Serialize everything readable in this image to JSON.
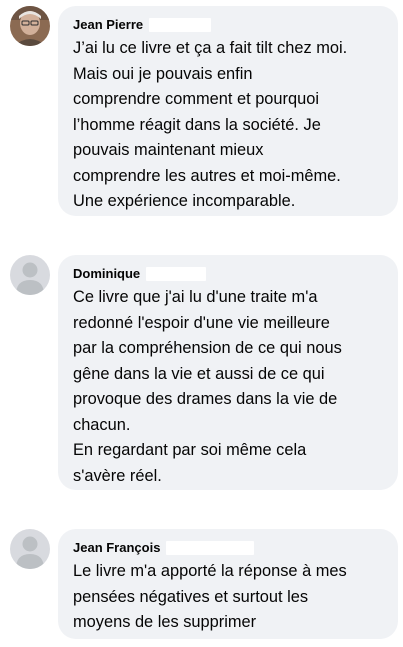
{
  "comments": [
    {
      "author": "Jean Pierre",
      "avatar_icon": "profile-photo",
      "text": "J’ai lu ce livre et ça a fait tilt chez moi.\nMais oui je pouvais enfin\ncomprendre comment et pourquoi\nl’homme réagit dans la société. Je\npouvais maintenant mieux\ncomprendre les autres et moi-même.\nUne expérience incomparable."
    },
    {
      "author": "Dominique",
      "avatar_icon": "default-user-icon",
      "text": "Ce livre que j'ai lu d'une traite m'a\nredonné l'espoir d'une vie meilleure\npar la compréhension de ce qui nous\ngêne dans la vie et aussi de ce qui\nprovoque des drames dans la vie de\nchacun.\nEn regardant par soi même cela\ns'avère réel."
    },
    {
      "author": "Jean François",
      "avatar_icon": "default-user-icon",
      "text": "Le livre m'a apporté la réponse à mes\npensées négatives et surtout les\nmoyens de les supprimer"
    }
  ],
  "colors": {
    "bubble_background": "#f0f2f5",
    "text": "#050505",
    "default_avatar_background": "#d8dadf",
    "default_avatar_figure": "#bcc0c4"
  }
}
